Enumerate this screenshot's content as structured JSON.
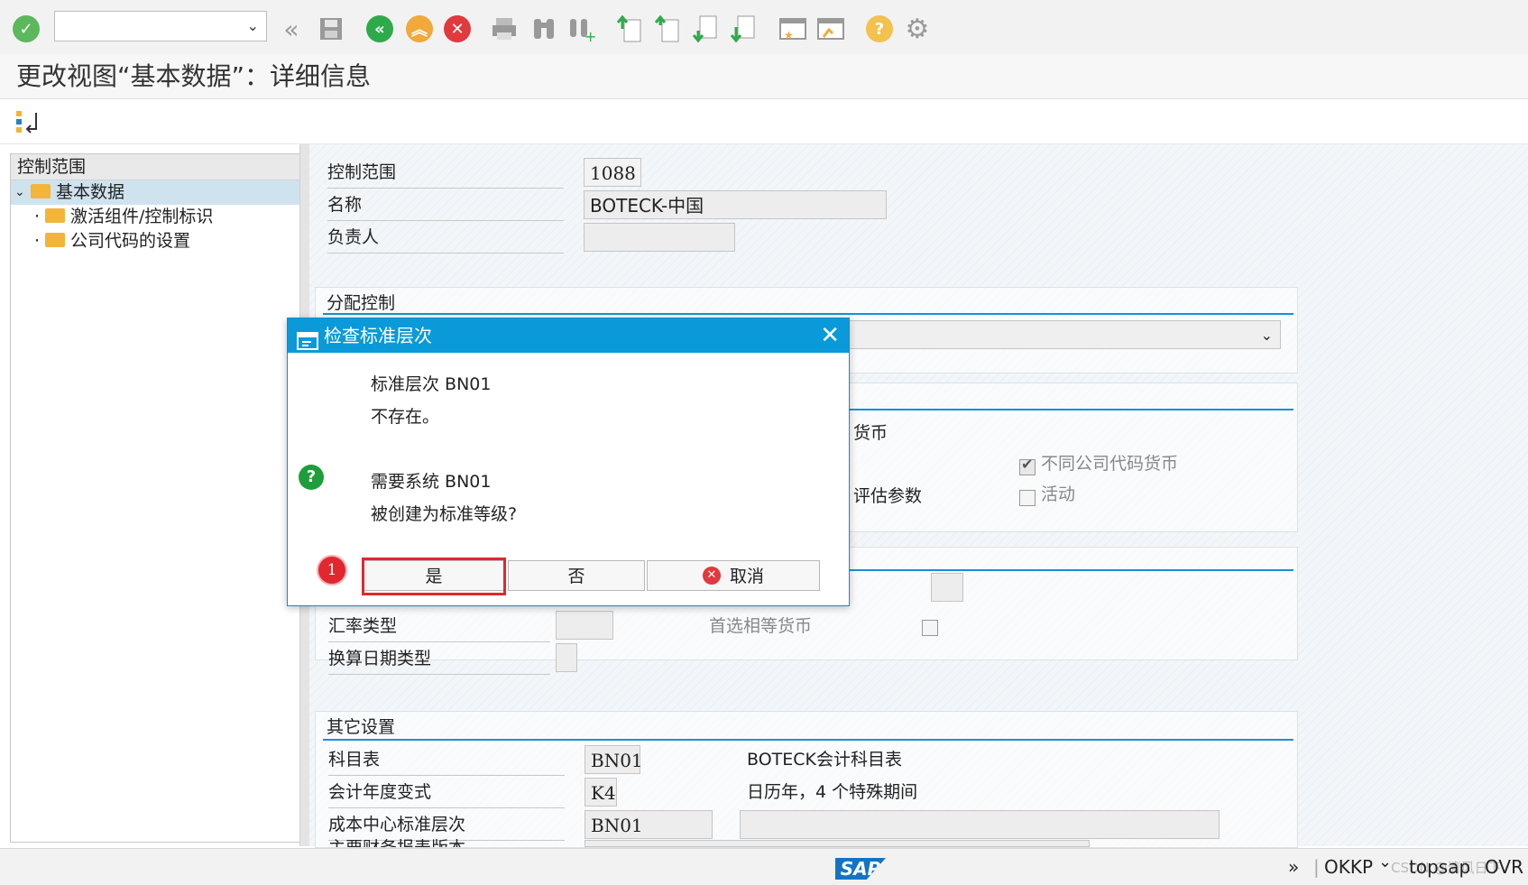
{
  "toolbar": {
    "command_value": "",
    "icons": [
      "enter-icon",
      "back-double-icon",
      "save-icon",
      "back-icon",
      "exit-icon",
      "cancel-icon",
      "print-icon",
      "find-icon",
      "find-next-icon",
      "first-page-icon",
      "prev-page-icon",
      "next-page-icon",
      "last-page-icon",
      "new-session-icon",
      "shortcut-icon",
      "help-icon",
      "settings-icon"
    ]
  },
  "page": {
    "title": "更改视图“基本数据”：详细信息"
  },
  "nav": {
    "header": "控制范围",
    "items": [
      {
        "label": "基本数据",
        "selected": true
      },
      {
        "label": "激活组件/控制标识"
      },
      {
        "label": "公司代码的设置"
      }
    ]
  },
  "form": {
    "header_fields": {
      "control_area_label": "控制范围",
      "control_area_value": "1088",
      "name_label": "名称",
      "name_value": "BOTECK-中国",
      "responsible_label": "负责人",
      "responsible_value": ""
    },
    "assignment": {
      "title": "分配控制"
    },
    "currency_partial": {
      "text1": "货币",
      "text2": "评估参数",
      "cb_diff_cc_currency": "不同公司代码货币",
      "cb_active": "活动"
    },
    "currency_fields": {
      "rate_type_label": "汇率类型",
      "translation_date_label": "换算日期类型",
      "preferred_currency_label": "首选相等货币"
    },
    "other": {
      "title": "其它设置",
      "coa_label": "科目表",
      "coa_value": "BN01",
      "coa_desc": "BOTECK会计科目表",
      "fy_label": "会计年度变式",
      "fy_value": "K4",
      "fy_desc": "日历年，4 个特殊期间",
      "cc_hier_label": "成本中心标准层次",
      "cc_hier_value": "BN01",
      "cut_label": "主要财务报表版本"
    }
  },
  "dialog": {
    "title": "检查标准层次",
    "line1": "标准层次 BN01",
    "line2": "不存在。",
    "line3": "需要系统 BN01",
    "line4": "被创建为标准等级?",
    "yes": "是",
    "no": "否",
    "cancel": "取消",
    "step_marker": "1"
  },
  "status": {
    "transaction": "OKKP",
    "system": "topsap",
    "mode": "OVR",
    "watermark": "CSDN @清风日下",
    "logo": "SAP"
  },
  "colors": {
    "accent": "#0a9ad9",
    "check_green": "#5cb85c",
    "icon_green": "#2eaa4a",
    "exit_orange": "#f0a93a",
    "cancel_red": "#e0393e",
    "highlight_red": "#e0282e"
  }
}
